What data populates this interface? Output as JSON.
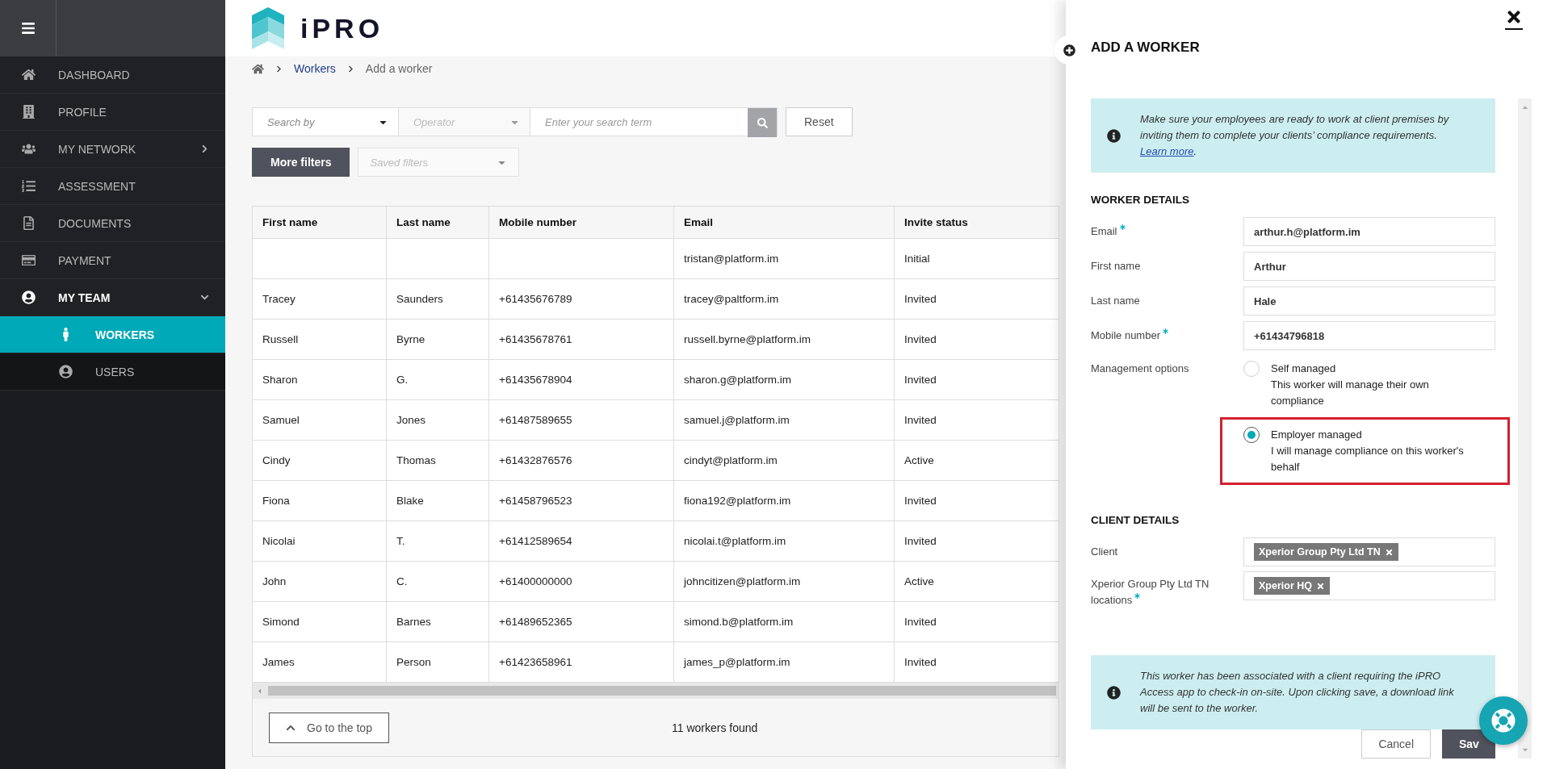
{
  "app": {
    "logo_text": "iPRO"
  },
  "sidebar": {
    "items": [
      {
        "label": "DASHBOARD",
        "kind": "link",
        "selected": false
      },
      {
        "label": "PROFILE",
        "kind": "link",
        "selected": false
      },
      {
        "label": "MY NETWORK",
        "kind": "group",
        "selected": false,
        "expanded": false
      },
      {
        "label": "ASSESSMENT",
        "kind": "link",
        "selected": false
      },
      {
        "label": "DOCUMENTS",
        "kind": "link",
        "selected": false
      },
      {
        "label": "PAYMENT",
        "kind": "link",
        "selected": false
      },
      {
        "label": "MY TEAM",
        "kind": "group",
        "selected": false,
        "expanded": true,
        "children": [
          {
            "label": "WORKERS",
            "selected": true
          },
          {
            "label": "USERS",
            "selected": false
          }
        ]
      }
    ]
  },
  "breadcrumb": [
    {
      "label": "Workers",
      "kind": "link"
    },
    {
      "label": "Add a worker",
      "kind": "current"
    }
  ],
  "filters": {
    "search_by": {
      "placeholder": "Search by"
    },
    "operator": {
      "placeholder": "Operator",
      "disabled": true
    },
    "term": {
      "placeholder": "Enter your search term"
    },
    "reset": "Reset",
    "more_filters": "More filters",
    "saved_filters": {
      "placeholder": "Saved filters"
    }
  },
  "table": {
    "columns": [
      "First name",
      "Last name",
      "Mobile number",
      "Email",
      "Invite status"
    ],
    "rows": [
      [
        null,
        null,
        null,
        "tristan@platform.im",
        "Initial"
      ],
      [
        "Tracey",
        "Saunders",
        "+61435676789",
        "tracey@paltform.im",
        "Invited"
      ],
      [
        "Russell",
        "Byrne",
        "+61435678761",
        "russell.byrne@platform.im",
        "Invited"
      ],
      [
        "Sharon",
        "G.",
        "+61435678904",
        "sharon.g@platform.im",
        "Invited"
      ],
      [
        "Samuel",
        "Jones",
        "+61487589655",
        "samuel.j@platform.im",
        "Invited"
      ],
      [
        "Cindy",
        "Thomas",
        "+61432876576",
        "cindyt@platform.im",
        "Active"
      ],
      [
        "Fiona",
        "Blake",
        "+61458796523",
        "fiona192@platform.im",
        "Invited"
      ],
      [
        "Nicolai",
        "T.",
        "+61412589654",
        "nicolai.t@platform.im",
        "Invited"
      ],
      [
        "John",
        "C.",
        "+61400000000",
        "johncitizen@platform.im",
        "Active"
      ],
      [
        "Simond",
        "Barnes",
        "+61489652365",
        "simond.b@platform.im",
        "Invited"
      ],
      [
        "James",
        "Person",
        "+61423658961",
        "james_p@platform.im",
        "Invited"
      ]
    ]
  },
  "footer": {
    "go_top": "Go to the top",
    "count": "11 workers found"
  },
  "panel": {
    "title": "ADD A WORKER",
    "info": {
      "text": "Make sure your employees are ready to work at client premises by inviting them to complete your clients’ compliance requirements.",
      "link": "Learn more",
      "after": "."
    },
    "worker_details": {
      "heading": "WORKER DETAILS",
      "fields": [
        {
          "label": "Email",
          "required": true,
          "value": "arthur.h@platform.im"
        },
        {
          "label": "First name",
          "required": false,
          "value": "Arthur"
        },
        {
          "label": "Last name",
          "required": false,
          "value": "Hale"
        },
        {
          "label": "Mobile number",
          "required": true,
          "value": "+61434796818"
        }
      ],
      "management": {
        "label": "Management options",
        "options": [
          {
            "title": "Self managed",
            "description": "This worker will manage their own compliance",
            "selected": false,
            "highlighted": false
          },
          {
            "title": "Employer managed",
            "description": "I will manage compliance on this worker's behalf",
            "selected": true,
            "highlighted": true
          }
        ]
      }
    },
    "client_details": {
      "heading": "CLIENT DETAILS",
      "fields": [
        {
          "label": "Client",
          "required": false,
          "tags": [
            "Xperior Group Pty Ltd TN"
          ]
        },
        {
          "label": "Xperior Group Pty Ltd TN locations",
          "required": true,
          "tags": [
            "Xperior HQ"
          ]
        }
      ]
    },
    "notice": "This worker has been associated with a client requiring the iPRO Access app to check-in on-site. Upon clicking save, a download link will be sent to the worker.",
    "buttons": {
      "cancel": "Cancel",
      "save": "Sav"
    }
  }
}
